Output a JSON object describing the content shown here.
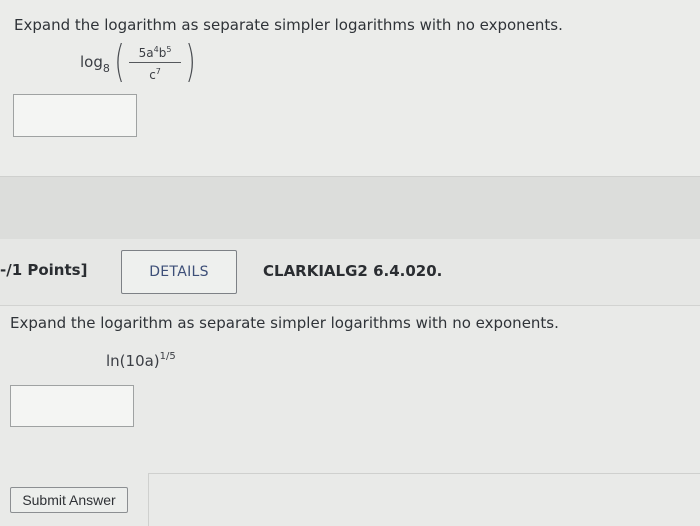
{
  "question1": {
    "prompt": "Expand the logarithm as separate simpler logarithms with no exponents.",
    "expression": {
      "func": "log",
      "base": "8",
      "numerator_coef": "5a",
      "numerator_a_exp": "4",
      "numerator_var_b": "b",
      "numerator_b_exp": "5",
      "denominator_var": "c",
      "denominator_exp": "7"
    },
    "answer_value": ""
  },
  "question2": {
    "points_label": "-/1 Points]",
    "details_label": "DETAILS",
    "problem_id": "CLARKIALG2 6.4.020.",
    "prompt": "Expand the logarithm as separate simpler logarithms with no exponents.",
    "expression": {
      "text": "ln(10a)",
      "exponent": "1/5"
    },
    "answer_value": "",
    "submit_label": "Submit Answer"
  }
}
